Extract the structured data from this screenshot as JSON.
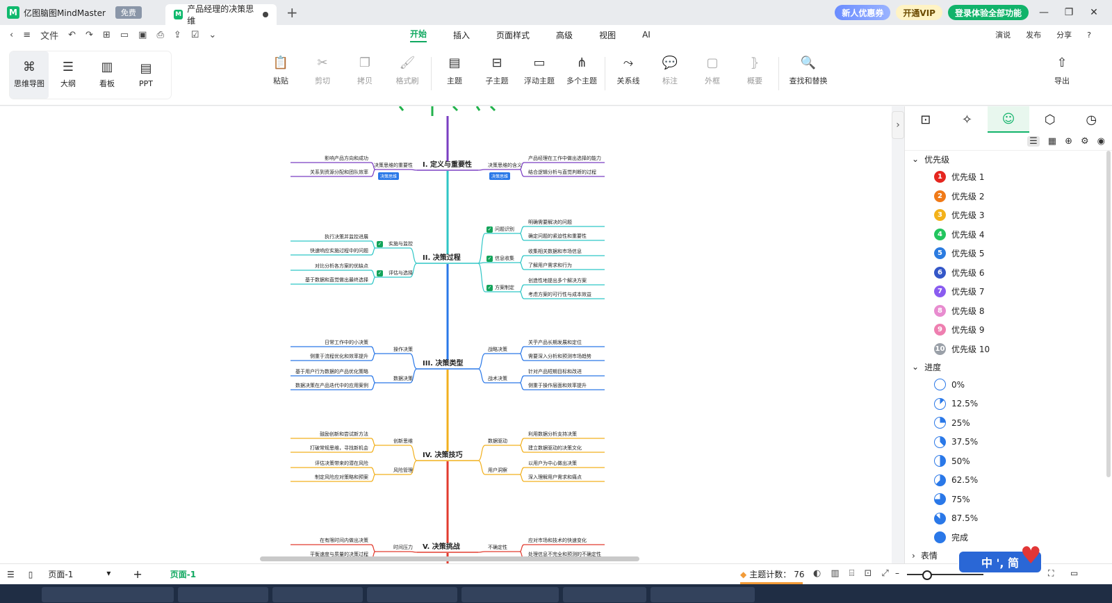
{
  "titlebar": {
    "app_name": "亿图脑图MindMaster",
    "free_badge": "免费",
    "doc_tab": "产品经理的决策思维",
    "coupon": "新人优惠券",
    "vip": "开通VIP",
    "login": "登录体验全部功能"
  },
  "menu": {
    "file": "文件",
    "tabs": [
      "开始",
      "插入",
      "页面样式",
      "高级",
      "视图",
      "AI"
    ],
    "active_tab": "开始",
    "right": [
      "演说",
      "发布",
      "分享"
    ]
  },
  "ribbon": {
    "views": [
      "思维导图",
      "大纲",
      "看板",
      "PPT"
    ],
    "active_view": "思维导图",
    "buttons": [
      {
        "label": "粘贴",
        "icon": "clipboard-icon"
      },
      {
        "label": "剪切",
        "icon": "scissors-icon"
      },
      {
        "label": "拷贝",
        "icon": "copy-icon"
      },
      {
        "label": "格式刷",
        "icon": "format-brush-icon"
      },
      {
        "label": "主题",
        "icon": "topic-icon"
      },
      {
        "label": "子主题",
        "icon": "subtopic-icon"
      },
      {
        "label": "浮动主题",
        "icon": "floating-topic-icon"
      },
      {
        "label": "多个主题",
        "icon": "multi-topic-icon"
      },
      {
        "label": "关系线",
        "icon": "relation-icon"
      },
      {
        "label": "标注",
        "icon": "callout-icon"
      },
      {
        "label": "外框",
        "icon": "boundary-icon"
      },
      {
        "label": "概要",
        "icon": "summary-icon"
      },
      {
        "label": "查找和替换",
        "icon": "find-replace-icon"
      }
    ],
    "export": "导出"
  },
  "mindmap": {
    "sections": [
      {
        "title": "I. 定义与重要性",
        "color": "#7a3ec2",
        "left": [
          {
            "label": "决策思维的重要性",
            "tag": "决策思维",
            "items": [
              "影响产品方向和成功",
              "关系到资源分配和团队效率"
            ]
          }
        ],
        "right": [
          {
            "label": "决策思维的含义",
            "tag": "决策思维",
            "items": [
              "产品经理在工作中做出选择的能力",
              "结合逻辑分析与直觉判断的过程"
            ]
          }
        ]
      },
      {
        "title": "II. 决策过程",
        "color": "#2fc6c6",
        "left": [
          {
            "label": "实施与监控",
            "items": [
              "执行决策并监控进展",
              "快速响应实施过程中的问题"
            ]
          },
          {
            "label": "评估与选择",
            "items": [
              "对比分析各方案的优缺点",
              "基于数据和直觉做出最终选择"
            ]
          }
        ],
        "right": [
          {
            "label": "问题识别",
            "items": [
              "明确需要解决的问题",
              "确定问题的紧迫性和重要性"
            ]
          },
          {
            "label": "信息收集",
            "items": [
              "收集相关数据和市场信息",
              "了解用户需求和行为"
            ]
          },
          {
            "label": "方案制定",
            "items": [
              "创造性地提出多个解决方案",
              "考虑方案的可行性与成本效益"
            ]
          }
        ]
      },
      {
        "title": "III. 决策类型",
        "color": "#2a78e8",
        "left": [
          {
            "label": "操作决策",
            "items": [
              "日常工作中的小决策",
              "侧重于流程优化和效率提升"
            ]
          },
          {
            "label": "数据决策",
            "items": [
              "基于用户行为数据的产品优化策略",
              "数据决策在产品迭代中的应用案例"
            ]
          }
        ],
        "right": [
          {
            "label": "战略决策",
            "items": [
              "关乎产品长期发展和定位",
              "需要深入分析和预测市场趋势"
            ]
          },
          {
            "label": "战术决策",
            "items": [
              "针对产品短期目标和改进",
              "侧重于操作层面和效率提升"
            ]
          }
        ]
      },
      {
        "title": "IV. 决策技巧",
        "color": "#f2b01e",
        "left": [
          {
            "label": "创新思维",
            "items": [
              "鼓励创新和尝试新方法",
              "打破常规思维，寻找新机会"
            ]
          },
          {
            "label": "风险管理",
            "items": [
              "评估决策带来的潜在风险",
              "制定风险应对策略和预案"
            ]
          }
        ],
        "right": [
          {
            "label": "数据驱动",
            "items": [
              "利用数据分析支持决策",
              "建立数据驱动的决策文化"
            ]
          },
          {
            "label": "用户洞察",
            "items": [
              "以用户为中心做出决策",
              "深入理解用户需求和痛点"
            ]
          }
        ]
      },
      {
        "title": "V. 决策挑战",
        "color": "#e23b2e",
        "left": [
          {
            "label": "时间压力",
            "items": [
              "在有限时间内做出决策",
              "平衡速度与质量的决策过程"
            ]
          }
        ],
        "right": [
          {
            "label": "不确定性",
            "items": [
              "应对市场和技术的快速变化",
              "处理信息不完全和预测的不确定性"
            ]
          }
        ]
      }
    ]
  },
  "panel": {
    "priority_title": "优先级",
    "priorities": [
      {
        "label": "优先级 1",
        "num": "1",
        "color": "#e5261f"
      },
      {
        "label": "优先级 2",
        "num": "2",
        "color": "#f07a18"
      },
      {
        "label": "优先级 3",
        "num": "3",
        "color": "#f3b21a"
      },
      {
        "label": "优先级 4",
        "num": "4",
        "color": "#22c55e"
      },
      {
        "label": "优先级 5",
        "num": "5",
        "color": "#2b7be0"
      },
      {
        "label": "优先级 6",
        "num": "6",
        "color": "#3457c8"
      },
      {
        "label": "优先级 7",
        "num": "7",
        "color": "#8a5cf0"
      },
      {
        "label": "优先级 8",
        "num": "8",
        "color": "#e88ccf"
      },
      {
        "label": "优先级 9",
        "num": "9",
        "color": "#ee7fb0"
      },
      {
        "label": "优先级 10",
        "num": "10",
        "color": "#9aa0a8"
      }
    ],
    "progress_title": "进度",
    "progress": [
      {
        "label": "0%",
        "pct": 0
      },
      {
        "label": "12.5%",
        "pct": 12.5
      },
      {
        "label": "25%",
        "pct": 25
      },
      {
        "label": "37.5%",
        "pct": 37.5
      },
      {
        "label": "50%",
        "pct": 50
      },
      {
        "label": "62.5%",
        "pct": 62.5
      },
      {
        "label": "75%",
        "pct": 75
      },
      {
        "label": "87.5%",
        "pct": 87.5
      },
      {
        "label": "完成",
        "pct": 100
      }
    ],
    "emotion_title": "表情"
  },
  "status": {
    "page_select": "页面-1",
    "page_tab": "页面-1",
    "topic_count_label": "主题计数：",
    "topic_count": "76"
  },
  "ime": {
    "label": "中 ', 简"
  }
}
